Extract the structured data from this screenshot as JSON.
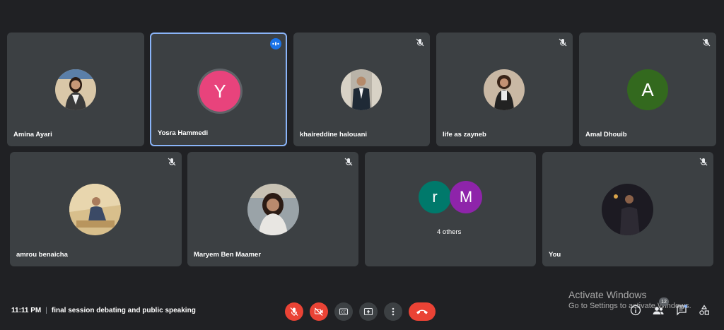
{
  "participants": [
    {
      "name": "Amina Ayari",
      "muted": false
    },
    {
      "name": "Yosra Hammedi",
      "initial": "Y",
      "avatar_color": "#e8437c",
      "speaking": true
    },
    {
      "name": "khaireddine halouani",
      "muted": true
    },
    {
      "name": "life as zayneb",
      "muted": true
    },
    {
      "name": "Amal Dhouib",
      "initial": "A",
      "avatar_color": "#33691e",
      "muted": true
    },
    {
      "name": "amrou benaicha",
      "muted": true
    },
    {
      "name": "Maryem Ben Maamer",
      "muted": true
    },
    {
      "name": "You",
      "muted": true
    }
  ],
  "others_tile": {
    "label": "4 others",
    "initials": [
      {
        "letter": "r",
        "color": "#00796b"
      },
      {
        "letter": "M",
        "color": "#8e24aa"
      }
    ]
  },
  "meeting": {
    "time": "11:11 PM",
    "separator": "|",
    "title": "final session debating and public speaking"
  },
  "controls": {
    "mic": "mic-off-icon",
    "camera": "camera-off-icon",
    "captions": "captions-icon",
    "present": "present-icon",
    "more": "more-vert-icon",
    "leave": "phone-hangup-icon"
  },
  "side_panel": {
    "participants_count": "12"
  },
  "watermark": {
    "line1": "Activate Windows",
    "line2": "Go to Settings to activate Windows."
  },
  "colors": {
    "background": "#202124",
    "tile": "#3c4043",
    "danger": "#ea4335",
    "accent": "#8ab4f8"
  }
}
